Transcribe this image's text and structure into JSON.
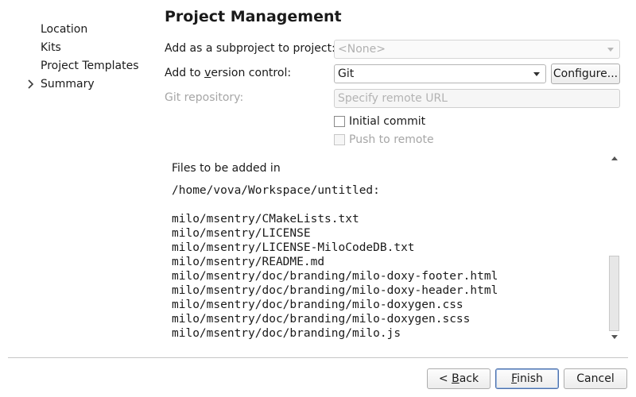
{
  "sidebar": {
    "items": [
      {
        "label": "Location",
        "current": false
      },
      {
        "label": "Kits",
        "current": false
      },
      {
        "label": "Project Templates",
        "current": false
      },
      {
        "label": "Summary",
        "current": true
      }
    ],
    "current_marker_icon": "chevron-right-icon"
  },
  "page_title": "Project Management",
  "subproject": {
    "label": "Add as a subproject to project:",
    "value": "<None>",
    "enabled": false
  },
  "version_control": {
    "label_before": "Add to ",
    "label_underlined": "v",
    "label_after": "ersion control:",
    "value": "Git",
    "configure_label": "Configure..."
  },
  "git_repository": {
    "label": "Git repository:",
    "placeholder": "Specify remote URL",
    "enabled": false
  },
  "initial_commit": {
    "label": "Initial commit",
    "checked": false
  },
  "push_to_remote": {
    "label": "Push to remote",
    "checked": false,
    "enabled": false
  },
  "files": {
    "heading": "Files to be added in",
    "path": "/home/vova/Workspace/untitled:",
    "list": [
      "milo/msentry/CMakeLists.txt",
      "milo/msentry/LICENSE",
      "milo/msentry/LICENSE-MiloCodeDB.txt",
      "milo/msentry/README.md",
      "milo/msentry/doc/branding/milo-doxy-footer.html",
      "milo/msentry/doc/branding/milo-doxy-header.html",
      "milo/msentry/doc/branding/milo-doxygen.css",
      "milo/msentry/doc/branding/milo-doxygen.scss",
      "milo/msentry/doc/branding/milo.js"
    ],
    "scroll": {
      "position_fraction": 0.0,
      "visible_fraction": 0.45
    }
  },
  "buttons": {
    "back": {
      "prefix": "< ",
      "underlined": "B",
      "suffix": "ack"
    },
    "finish": {
      "prefix": "",
      "underlined": "F",
      "suffix": "inish"
    },
    "cancel": {
      "label": "Cancel"
    }
  }
}
